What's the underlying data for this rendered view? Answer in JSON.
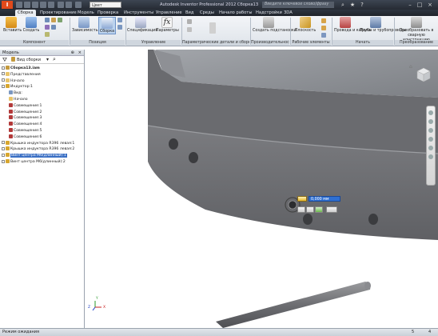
{
  "app": {
    "logo": "I",
    "qa_dropdown": "Цвет",
    "title": "Autodesk Inventor Professional 2012   Сборка13",
    "search_placeholder": "Введите ключевое слово/фразу"
  },
  "ribbon_tabs": [
    "Сборка",
    "Проектирование",
    "Модель",
    "Проверка",
    "Инструменты",
    "Управление",
    "Вид",
    "Среды",
    "Начало работы",
    "Надстройки",
    "3DA"
  ],
  "ribbon": {
    "buttons": {
      "insert": "Вставить",
      "create": "Создать",
      "pattern": "Зависимость",
      "assemble": "Сборка",
      "spec": "Спецификация",
      "params": "Параметры",
      "create_sub": "Создать подстановки",
      "plane": "Плоскость",
      "wires": "Провода и кабели",
      "pipes": "Трубы и трубопроводы",
      "convert": "Преобразовать в сварную конструкцию"
    },
    "groups": {
      "component": "Компонент",
      "position": "Позиция",
      "manage": "Управление",
      "params_group": "Параметрические детали и сборки",
      "productivity": "Производительность",
      "work_features": "Рабочие элементы",
      "begin": "Начать",
      "convert_group": "Преобразование"
    }
  },
  "browser": {
    "title": "Модель",
    "view_label": "Вид сборки",
    "tree": [
      {
        "label": "Сборка13.iam",
        "level": 0,
        "icon": "assembly",
        "bold": true
      },
      {
        "label": "Представления",
        "level": 0,
        "icon": "folder"
      },
      {
        "label": "Начало",
        "level": 0,
        "icon": "folder"
      },
      {
        "label": "Индуктор:1",
        "level": 0,
        "icon": "part"
      },
      {
        "label": "Вид:",
        "level": 1,
        "icon": "view"
      },
      {
        "label": "Начало",
        "level": 1,
        "icon": "folder"
      },
      {
        "label": "Совмещение:1",
        "level": 1,
        "icon": "constraint"
      },
      {
        "label": "Совмещение:2",
        "level": 1,
        "icon": "constraint"
      },
      {
        "label": "Совмещение:3",
        "level": 1,
        "icon": "constraint"
      },
      {
        "label": "Совмещение:4",
        "level": 1,
        "icon": "constraint"
      },
      {
        "label": "Совмещение:5",
        "level": 1,
        "icon": "constraint"
      },
      {
        "label": "Совмещение:6",
        "level": 1,
        "icon": "constraint"
      },
      {
        "label": "Крышка индуктора R396 левая:1",
        "level": 0,
        "icon": "part"
      },
      {
        "label": "Крышка индуктора R396 левая:2",
        "level": 0,
        "icon": "part"
      },
      {
        "label": "Винт центра М6(длинный):1",
        "level": 0,
        "icon": "part",
        "selected": true
      },
      {
        "label": "Винт центра М6(длинный):2",
        "level": 0,
        "icon": "part"
      }
    ]
  },
  "minitoolbar": {
    "dimension_value": "0,000 мм"
  },
  "axes": {
    "x": "X",
    "y": "Y",
    "z": "Z"
  },
  "status": {
    "left": "Режим ожидания",
    "num1": "5",
    "num2": "4"
  },
  "colors": {
    "part_face": "#6f7073",
    "part_top": "#8a8c8f",
    "selected_row": "#3a6fc4",
    "accent": "#e14a1b"
  }
}
